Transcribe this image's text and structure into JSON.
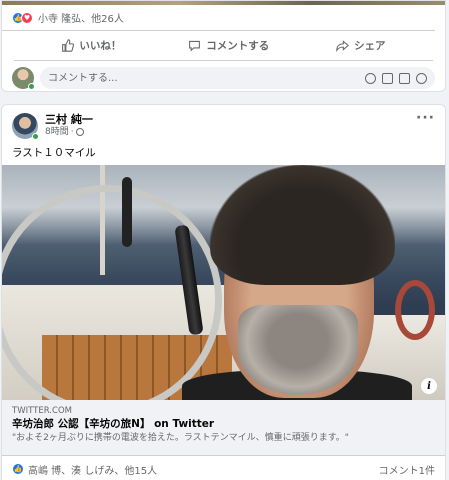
{
  "top_post": {
    "reactions_text": "小寺 隆弘、他26人",
    "actions": {
      "like": "いいね！",
      "comment": "コメントする",
      "share": "シェア"
    },
    "comment_placeholder": "コメントする..."
  },
  "post": {
    "author": "三村 純一",
    "time": "8時間",
    "text": "ラスト１０マイル",
    "link": {
      "domain": "TWITTER.COM",
      "title": "辛坊治郎 公認【辛坊の旅N】 on Twitter",
      "description": "\"およそ2ヶ月ぶりに携帯の電波を拾えた。ラストテンマイル、慎重に頑張ります。\""
    },
    "reactions_text": "高嶋 博、湊 しげみ、他15人",
    "comment_count": "コメント1件"
  },
  "icons": [
    "like-icon",
    "love-icon",
    "comment-icon",
    "share-icon",
    "emoji-icon",
    "camera-icon",
    "gif-icon",
    "sticker-icon",
    "globe-icon",
    "more-icon",
    "info-icon"
  ],
  "colors": {
    "like_blue": "#1877f2",
    "love_red": "#f33e58",
    "online_green": "#31a24c",
    "muted": "#65676b",
    "bg": "#f0f2f5"
  }
}
